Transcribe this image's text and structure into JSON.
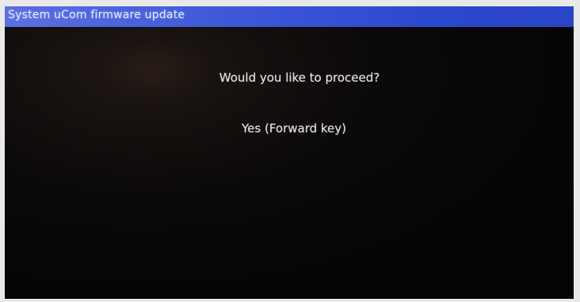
{
  "window": {
    "title": "System uCom firmware update"
  },
  "dialog": {
    "prompt": "Would you like to proceed?",
    "confirm_option": "Yes (Forward key)"
  },
  "colors": {
    "title_bar": "#3d58d8",
    "background": "#050505",
    "text": "#e2e2e2"
  }
}
